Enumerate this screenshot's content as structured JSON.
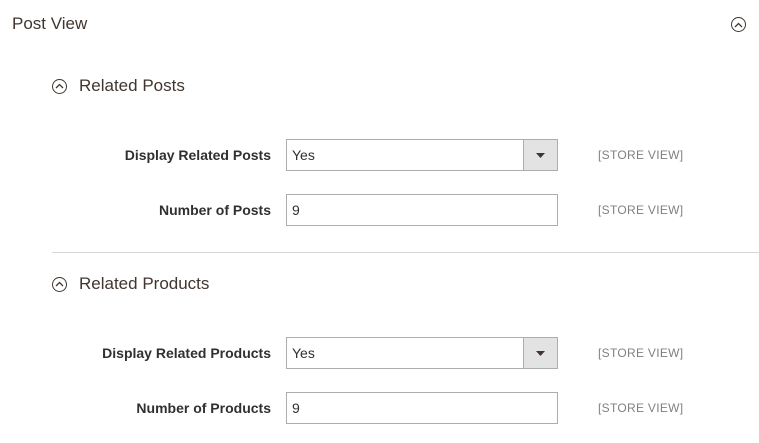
{
  "page": {
    "title": "Post View"
  },
  "sections": [
    {
      "title": "Related Posts",
      "rows": [
        {
          "label": "Display Related Posts",
          "type": "select",
          "value": "Yes",
          "scope": "[STORE VIEW]"
        },
        {
          "label": "Number of Posts",
          "type": "input",
          "value": "9",
          "scope": "[STORE VIEW]"
        }
      ]
    },
    {
      "title": "Related Products",
      "rows": [
        {
          "label": "Display Related Products",
          "type": "select",
          "value": "Yes",
          "scope": "[STORE VIEW]"
        },
        {
          "label": "Number of Products",
          "type": "input",
          "value": "9",
          "scope": "[STORE VIEW]"
        }
      ]
    }
  ],
  "icons": {
    "collapse": "chevron-up-circle-icon",
    "dropdown": "triangle-down-icon"
  },
  "colors": {
    "title": "#41362f",
    "border": "#adadad",
    "arrow_bg": "#e3e3e3",
    "scope": "#808080"
  }
}
